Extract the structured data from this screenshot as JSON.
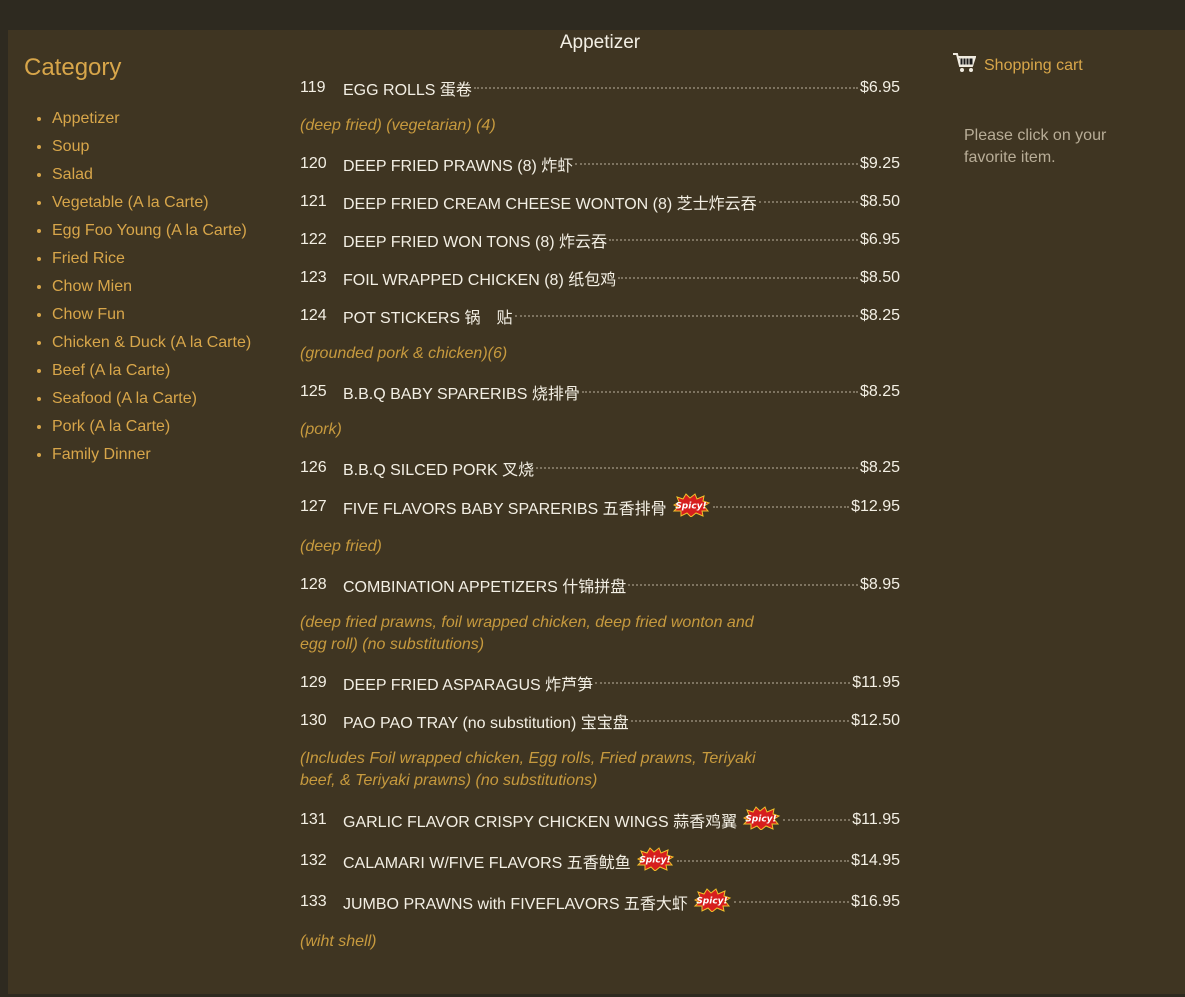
{
  "sidebar": {
    "title": "Category",
    "categories": [
      "Appetizer",
      "Soup",
      "Salad",
      "Vegetable (A la Carte)",
      "Egg Foo Young (A la Carte)",
      "Fried Rice",
      "Chow Mien",
      "Chow Fun",
      "Chicken & Duck (A la Carte)",
      "Beef (A la Carte)",
      "Seafood (A la Carte)",
      "Pork (A la Carte)",
      "Family Dinner"
    ]
  },
  "main": {
    "title": "Appetizer",
    "items": [
      {
        "num": "119",
        "name": "EGG ROLLS 蛋卷",
        "price": "$6.95"
      },
      {
        "num": "120",
        "name": "DEEP FRIED PRAWNS (8) 炸虾",
        "price": "$9.25"
      },
      {
        "num": "121",
        "name": "DEEP FRIED CREAM CHEESE WONTON (8) 芝士炸云吞",
        "price": "$8.50"
      },
      {
        "num": "122",
        "name": "DEEP FRIED WON TONS (8) 炸云吞",
        "price": "$6.95"
      },
      {
        "num": "123",
        "name": "FOIL WRAPPED CHICKEN (8) 纸包鸡",
        "price": "$8.50"
      },
      {
        "num": "124",
        "name": "POT STICKERS 锅　贴",
        "price": "$8.25"
      },
      {
        "num": "125",
        "name": "B.B.Q BABY SPARERIBS 烧排骨",
        "price": "$8.25"
      },
      {
        "num": "126",
        "name": "B.B.Q SILCED PORK 叉烧",
        "price": "$8.25"
      },
      {
        "num": "127",
        "name": "FIVE FLAVORS BABY SPARERIBS 五香排骨",
        "price": "$12.95"
      },
      {
        "num": "128",
        "name": "COMBINATION APPETIZERS 什锦拼盘",
        "price": "$8.95"
      },
      {
        "num": "129",
        "name": "DEEP FRIED ASPARAGUS 炸芦笋",
        "price": "$11.95"
      },
      {
        "num": "130",
        "name": "PAO PAO TRAY (no substitution) 宝宝盘",
        "price": "$12.50"
      },
      {
        "num": "131",
        "name": "GARLIC FLAVOR CRISPY CHICKEN WINGS 蒜香鸡翼",
        "price": "$11.95"
      },
      {
        "num": "132",
        "name": "CALAMARI W/FIVE FLAVORS 五香鱿鱼",
        "price": "$14.95"
      },
      {
        "num": "133",
        "name": "JUMBO PRAWNS with FIVEFLAVORS 五香大虾",
        "price": "$16.95"
      }
    ],
    "descriptions": [
      "(deep fried) (vegetarian) (4)",
      "(grounded pork & chicken)(6)",
      "(pork)",
      "(deep fried)",
      "(deep fried prawns, foil wrapped chicken, deep fried wonton and egg roll) (no substitutions)",
      "(Includes Foil wrapped chicken, Egg rolls, Fried prawns, Teriyaki beef, & Teriyaki prawns) (no substitutions)",
      "(wiht shell)"
    ],
    "spicy_label": "Spicy!",
    "spicy_icon": "spicy-burst-icon"
  },
  "cart": {
    "title": "Shopping cart",
    "message": "Please click on your favorite item.",
    "icon": "shopping-cart-icon"
  }
}
